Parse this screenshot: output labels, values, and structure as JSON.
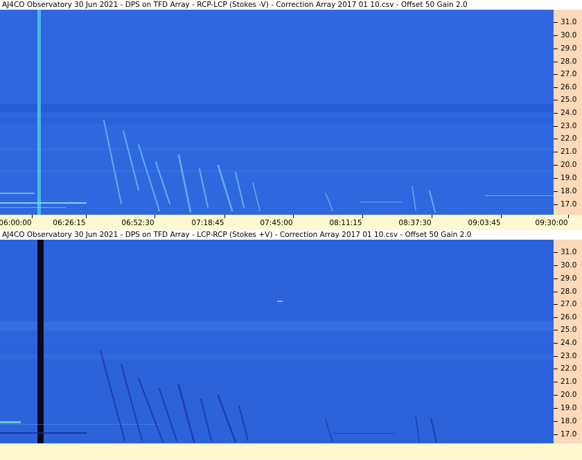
{
  "panels": [
    {
      "title": "AJ4CO Observatory 30 Jun 2021  -  DPS on TFD Array  -  RCP-LCP (Stokes -V)  -  Correction Array 2017 01 10.csv  -  Offset 50  Gain 2.0",
      "mode": "RCP-LCP (Stokes -V)"
    },
    {
      "title": "AJ4CO Observatory 30 Jun 2021  -  DPS on TFD Array  -  LCP-RCP (Stokes +V)  -  Correction Array 2017 01 10.csv  -  Offset 50  Gain 2.0",
      "mode": "LCP-RCP (Stokes +V)"
    }
  ],
  "freq_ticks": [
    "31.0",
    "30.0",
    "29.0",
    "28.0",
    "27.0",
    "26.0",
    "25.0",
    "24.0",
    "23.0",
    "22.0",
    "21.0",
    "20.0",
    "19.0",
    "18.0",
    "17.0"
  ],
  "time_ticks": [
    "06:00:00",
    "06:26:15",
    "06:52:30",
    "07:18:45",
    "07:45:00",
    "08:11:15",
    "08:37:30",
    "09:03:45",
    "09:30:00"
  ],
  "colors": {
    "background": "#2e66dd",
    "axis_panel": "#fcd9b8",
    "time_axis": "#fff8d0",
    "top_burst": "#6ec7f5",
    "bottom_burst": "#1b2ea8"
  }
}
